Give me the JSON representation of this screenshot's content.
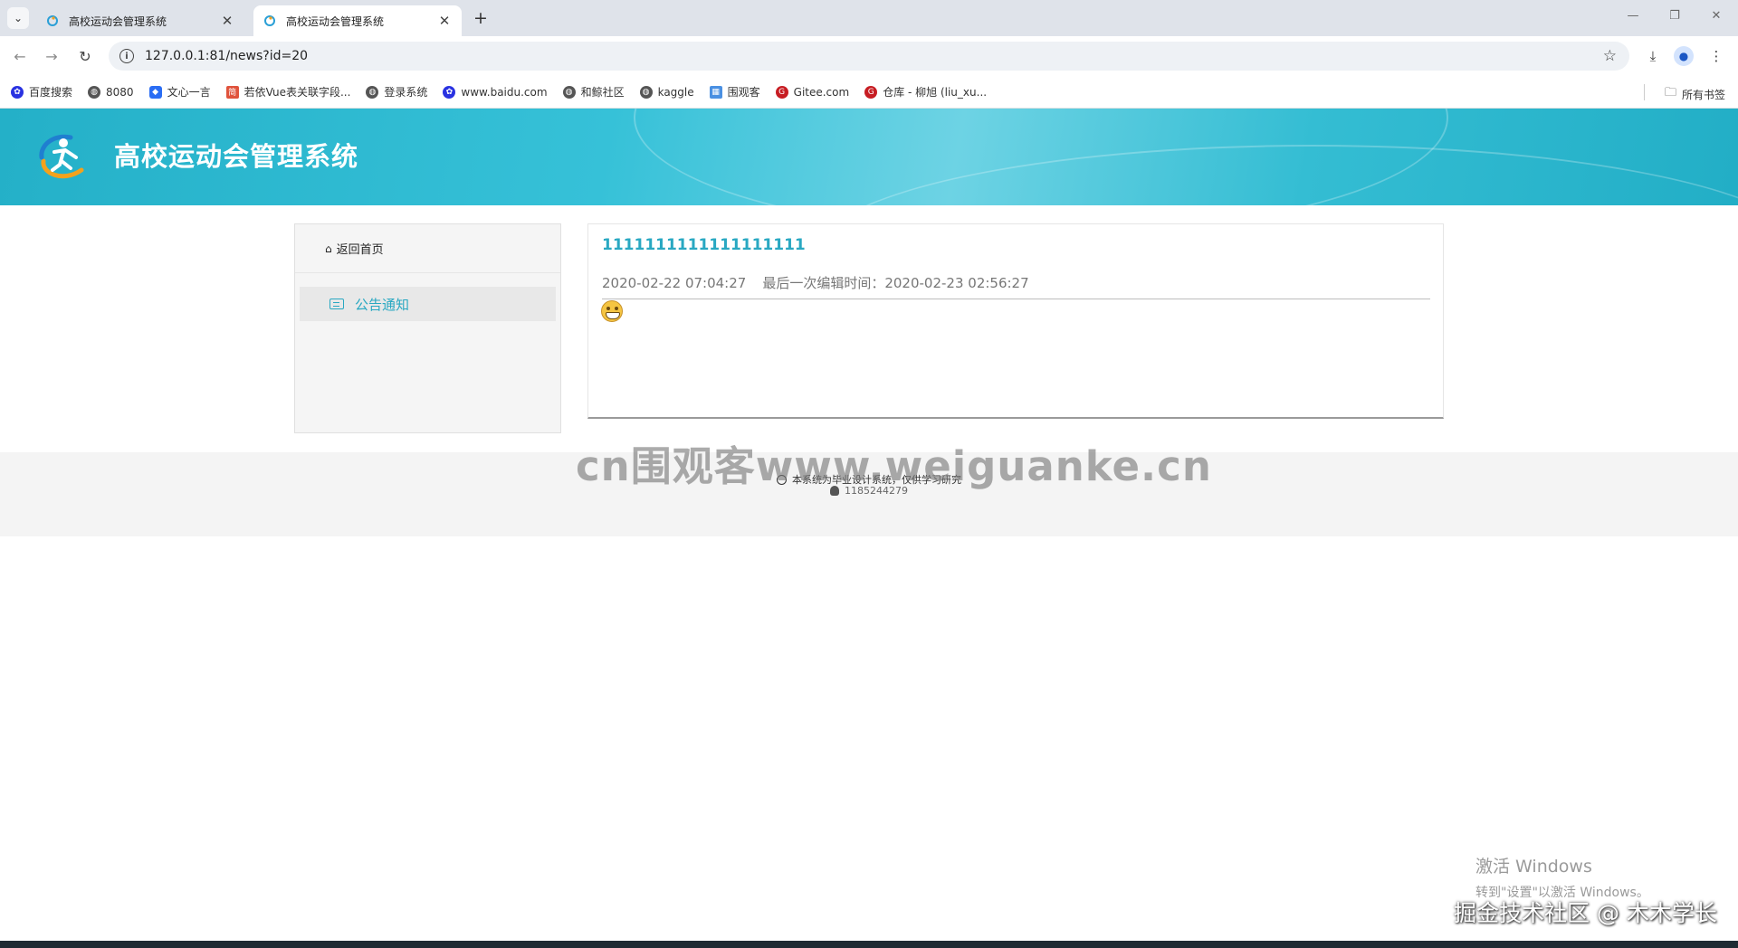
{
  "browser": {
    "tabs": [
      {
        "title": "高校运动会管理系统",
        "active": false
      },
      {
        "title": "高校运动会管理系统",
        "active": true
      }
    ],
    "new_tab_label": "+",
    "url": "127.0.0.1:81/news?id=20",
    "bookmarks": [
      {
        "label": "百度搜索",
        "icon": "baidu-icon",
        "color": "#2932e1"
      },
      {
        "label": "8080",
        "icon": "globe-icon",
        "color": "#555555"
      },
      {
        "label": "文心一言",
        "icon": "wenxin-icon",
        "color": "#2a6df4"
      },
      {
        "label": "若依Vue表关联字段...",
        "icon": "ruoyi-icon",
        "color": "#e0533c"
      },
      {
        "label": "登录系统",
        "icon": "globe-icon",
        "color": "#555555"
      },
      {
        "label": "www.baidu.com",
        "icon": "baidu-icon",
        "color": "#2932e1"
      },
      {
        "label": "和鲸社区",
        "icon": "globe-icon",
        "color": "#555555"
      },
      {
        "label": "kaggle",
        "icon": "globe-icon",
        "color": "#555555"
      },
      {
        "label": "围观客",
        "icon": "weiguanke-icon",
        "color": "#4a90e2"
      },
      {
        "label": "Gitee.com",
        "icon": "gitee-icon",
        "color": "#c71d23"
      },
      {
        "label": "仓库 - 柳旭 (liu_xu...",
        "icon": "gitee-icon",
        "color": "#c71d23"
      }
    ],
    "all_bookmarks_label": "所有书签"
  },
  "site": {
    "title": "高校运动会管理系统"
  },
  "sidebar": {
    "home_label": "返回首页",
    "items": [
      {
        "label": "公告通知",
        "active": true
      }
    ]
  },
  "news": {
    "title": "1111111111111111111",
    "created": "2020-02-22 07:04:27",
    "edited_label": "最后一次编辑时间：",
    "edited": "2020-02-23 02:56:27"
  },
  "footer": {
    "line1": "本系统为毕业设计系统，仅供学习研究",
    "qq": "1185244279"
  },
  "overlay": {
    "watermark": "cn围观客www.weiguanke.cn",
    "activate_title": "激活 Windows",
    "activate_sub": "转到\"设置\"以激活 Windows。",
    "corner_watermark": "掘金技术社区 @ 木木学长"
  },
  "colors": {
    "accent": "#29a8c2",
    "banner": "#2fb8cf"
  }
}
